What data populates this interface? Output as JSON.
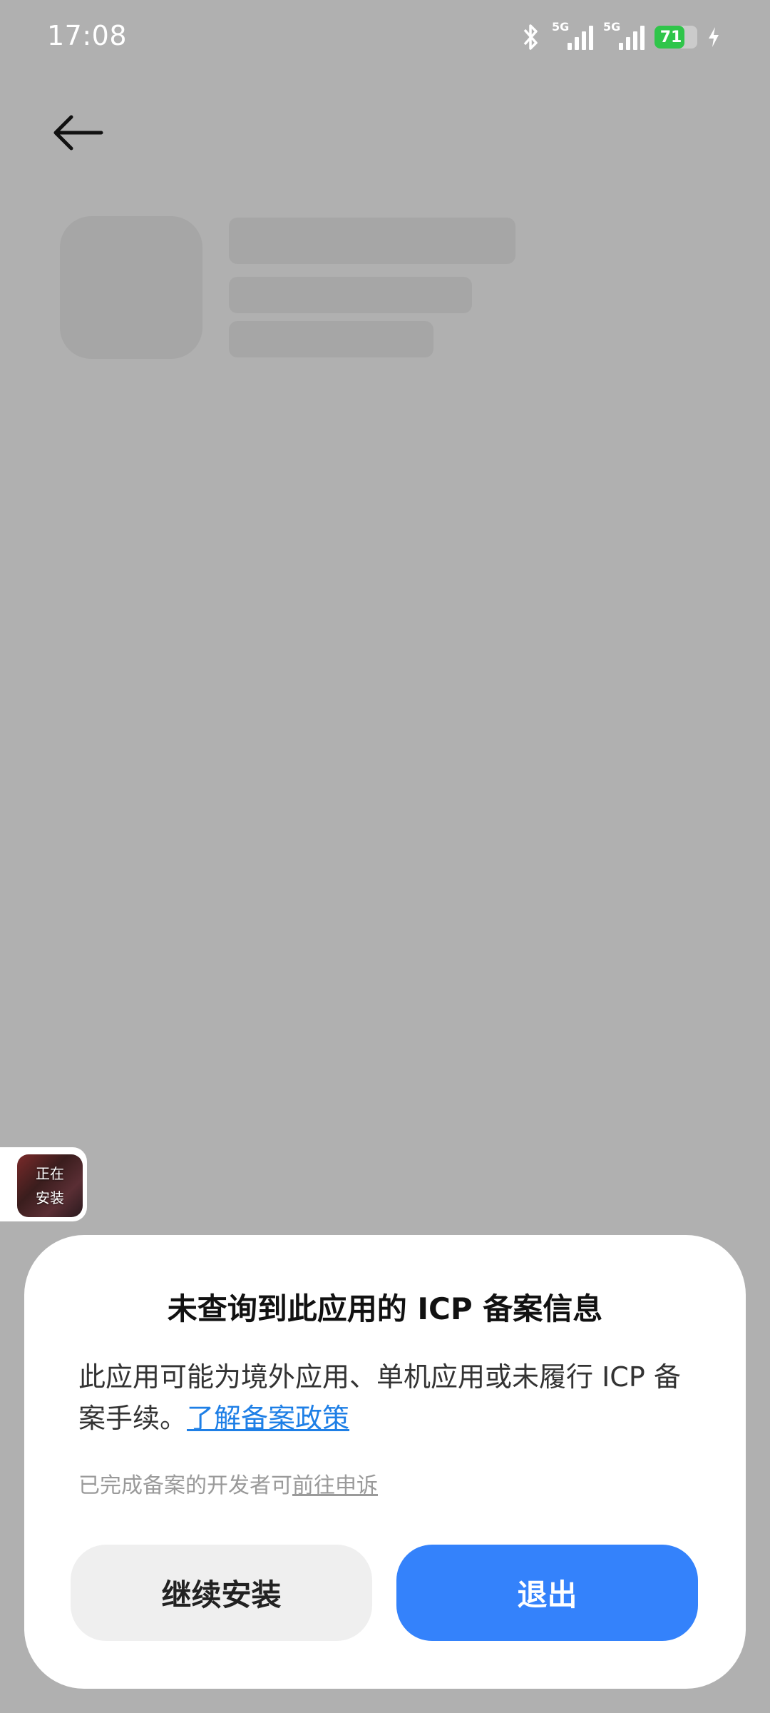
{
  "status_bar": {
    "time": "17:08",
    "network_1": "5G",
    "network_2": "5G",
    "battery_level": "71",
    "icons": [
      "bluetooth-icon",
      "signal-icon",
      "signal-icon",
      "battery-icon",
      "charging-icon"
    ]
  },
  "header": {
    "back_icon": "arrow-left-icon"
  },
  "install_widget": {
    "line1": "正在",
    "line2": "安装"
  },
  "dialog": {
    "title": "未查询到此应用的 ICP 备案信息",
    "body_text": "此应用可能为境外应用、单机应用或未履行 ICP 备案手续。",
    "policy_link": "了解备案政策",
    "note_text": "已完成备案的开发者可",
    "appeal_link": "前往申诉",
    "continue_label": "继续安装",
    "exit_label": "退出"
  },
  "colors": {
    "overlay_bg": "#b0b0b0",
    "accent_blue": "#3482fb",
    "link_blue": "#1e7fe6",
    "battery_green": "#2fc54a"
  }
}
